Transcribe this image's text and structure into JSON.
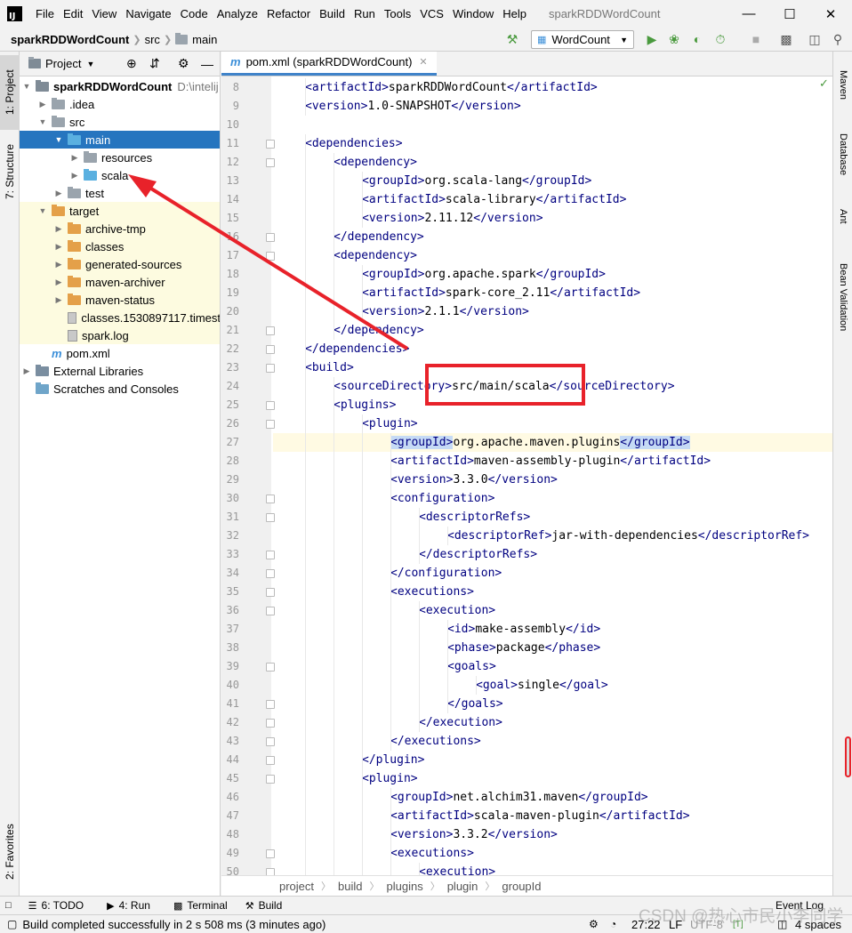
{
  "menubar": {
    "logo": "IJ",
    "items": [
      {
        "label": "File"
      },
      {
        "label": "Edit"
      },
      {
        "label": "View"
      },
      {
        "label": "Navigate"
      },
      {
        "label": "Code"
      },
      {
        "label": "Analyze"
      },
      {
        "label": "Refactor"
      },
      {
        "label": "Build"
      },
      {
        "label": "Run"
      },
      {
        "label": "Tools"
      },
      {
        "label": "VCS"
      },
      {
        "label": "Window"
      },
      {
        "label": "Help"
      }
    ],
    "window_title": "sparkRDDWordCount"
  },
  "navbar": {
    "crumbs": [
      "sparkRDDWordCount",
      "src",
      "main"
    ],
    "run_config": "WordCount"
  },
  "left_strip": {
    "project_tab": "1: Project",
    "structure_tab": "7: Structure",
    "favorites_tab": "2: Favorites"
  },
  "right_strip": {
    "tabs": [
      "Maven",
      "Database",
      "Ant",
      "Bean Validation"
    ]
  },
  "project": {
    "title": "Project",
    "tree": [
      {
        "label": "sparkRDDWordCount",
        "extra": "D:\\intelij"
      },
      {
        "label": ".idea"
      },
      {
        "label": "src"
      },
      {
        "label": "main"
      },
      {
        "label": "resources"
      },
      {
        "label": "scala"
      },
      {
        "label": "test"
      },
      {
        "label": "target"
      },
      {
        "label": "archive-tmp"
      },
      {
        "label": "classes"
      },
      {
        "label": "generated-sources"
      },
      {
        "label": "maven-archiver"
      },
      {
        "label": "maven-status"
      },
      {
        "label": "classes.1530897117.timest"
      },
      {
        "label": "spark.log"
      },
      {
        "label": "pom.xml"
      },
      {
        "label": "External Libraries"
      },
      {
        "label": "Scratches and Consoles"
      }
    ]
  },
  "editor": {
    "tab_label": "pom.xml (sparkRDDWordCount)",
    "lines": [
      {
        "num": "8",
        "indent": 1,
        "parts": [
          [
            "tag",
            "<artifactId>"
          ],
          [
            "text",
            "sparkRDDWordCount"
          ],
          [
            "tag",
            "</artifactId>"
          ]
        ]
      },
      {
        "num": "9",
        "indent": 1,
        "parts": [
          [
            "tag",
            "<version>"
          ],
          [
            "text",
            "1.0-SNAPSHOT"
          ],
          [
            "tag",
            "</version>"
          ]
        ]
      },
      {
        "num": "10",
        "indent": 0,
        "parts": []
      },
      {
        "num": "11",
        "indent": 1,
        "parts": [
          [
            "tag",
            "<dependencies>"
          ]
        ]
      },
      {
        "num": "12",
        "indent": 2,
        "parts": [
          [
            "tag",
            "<dependency>"
          ]
        ]
      },
      {
        "num": "13",
        "indent": 3,
        "parts": [
          [
            "tag",
            "<groupId>"
          ],
          [
            "text",
            "org.scala-lang"
          ],
          [
            "tag",
            "</groupId>"
          ]
        ]
      },
      {
        "num": "14",
        "indent": 3,
        "parts": [
          [
            "tag",
            "<artifactId>"
          ],
          [
            "text",
            "scala-library"
          ],
          [
            "tag",
            "</artifactId>"
          ]
        ]
      },
      {
        "num": "15",
        "indent": 3,
        "parts": [
          [
            "tag",
            "<version>"
          ],
          [
            "text",
            "2.11.12"
          ],
          [
            "tag",
            "</version>"
          ]
        ]
      },
      {
        "num": "16",
        "indent": 2,
        "parts": [
          [
            "tag",
            "</dependency>"
          ]
        ]
      },
      {
        "num": "17",
        "indent": 2,
        "parts": [
          [
            "tag",
            "<dependency>"
          ]
        ]
      },
      {
        "num": "18",
        "indent": 3,
        "parts": [
          [
            "tag",
            "<groupId>"
          ],
          [
            "text",
            "org.apache.spark"
          ],
          [
            "tag",
            "</groupId>"
          ]
        ]
      },
      {
        "num": "19",
        "indent": 3,
        "parts": [
          [
            "tag",
            "<artifactId>"
          ],
          [
            "text",
            "spark-core_2.11"
          ],
          [
            "tag",
            "</artifactId>"
          ]
        ]
      },
      {
        "num": "20",
        "indent": 3,
        "parts": [
          [
            "tag",
            "<version>"
          ],
          [
            "text",
            "2.1.1"
          ],
          [
            "tag",
            "</version>"
          ]
        ]
      },
      {
        "num": "21",
        "indent": 2,
        "parts": [
          [
            "tag",
            "</dependency>"
          ]
        ]
      },
      {
        "num": "22",
        "indent": 1,
        "parts": [
          [
            "tag",
            "</dependencies>"
          ]
        ]
      },
      {
        "num": "23",
        "indent": 1,
        "parts": [
          [
            "tag",
            "<build>"
          ]
        ]
      },
      {
        "num": "24",
        "indent": 2,
        "parts": [
          [
            "tag",
            "<sourceDirectory>"
          ],
          [
            "text",
            "src/main/scala"
          ],
          [
            "tag",
            "</sourceDirectory>"
          ]
        ]
      },
      {
        "num": "25",
        "indent": 2,
        "parts": [
          [
            "tag",
            "<plugins>"
          ]
        ]
      },
      {
        "num": "26",
        "indent": 3,
        "parts": [
          [
            "tag",
            "<plugin>"
          ]
        ]
      },
      {
        "num": "27",
        "indent": 4,
        "current": true,
        "parts": [
          [
            "taghl",
            "<groupId>"
          ],
          [
            "text",
            "org.apache.maven.plugins"
          ],
          [
            "taghl",
            "</groupId>"
          ]
        ]
      },
      {
        "num": "28",
        "indent": 4,
        "parts": [
          [
            "tag",
            "<artifactId>"
          ],
          [
            "text",
            "maven-assembly-plugin"
          ],
          [
            "tag",
            "</artifactId>"
          ]
        ]
      },
      {
        "num": "29",
        "indent": 4,
        "parts": [
          [
            "tag",
            "<version>"
          ],
          [
            "text",
            "3.3.0"
          ],
          [
            "tag",
            "</version>"
          ]
        ]
      },
      {
        "num": "30",
        "indent": 4,
        "parts": [
          [
            "tag",
            "<configuration>"
          ]
        ]
      },
      {
        "num": "31",
        "indent": 5,
        "parts": [
          [
            "tag",
            "<descriptorRefs>"
          ]
        ]
      },
      {
        "num": "32",
        "indent": 6,
        "parts": [
          [
            "tag",
            "<descriptorRef>"
          ],
          [
            "text",
            "jar-with-dependencies"
          ],
          [
            "tag",
            "</descriptorRef>"
          ]
        ]
      },
      {
        "num": "33",
        "indent": 5,
        "parts": [
          [
            "tag",
            "</descriptorRefs>"
          ]
        ]
      },
      {
        "num": "34",
        "indent": 4,
        "parts": [
          [
            "tag",
            "</configuration>"
          ]
        ]
      },
      {
        "num": "35",
        "indent": 4,
        "parts": [
          [
            "tag",
            "<executions>"
          ]
        ]
      },
      {
        "num": "36",
        "indent": 5,
        "parts": [
          [
            "tag",
            "<execution>"
          ]
        ]
      },
      {
        "num": "37",
        "indent": 6,
        "parts": [
          [
            "tag",
            "<id>"
          ],
          [
            "text",
            "make-assembly"
          ],
          [
            "tag",
            "</id>"
          ]
        ]
      },
      {
        "num": "38",
        "indent": 6,
        "parts": [
          [
            "tag",
            "<phase>"
          ],
          [
            "text",
            "package"
          ],
          [
            "tag",
            "</phase>"
          ]
        ]
      },
      {
        "num": "39",
        "indent": 6,
        "parts": [
          [
            "tag",
            "<goals>"
          ]
        ]
      },
      {
        "num": "40",
        "indent": 7,
        "parts": [
          [
            "tag",
            "<goal>"
          ],
          [
            "text",
            "single"
          ],
          [
            "tag",
            "</goal>"
          ]
        ]
      },
      {
        "num": "41",
        "indent": 6,
        "parts": [
          [
            "tag",
            "</goals>"
          ]
        ]
      },
      {
        "num": "42",
        "indent": 5,
        "parts": [
          [
            "tag",
            "</execution>"
          ]
        ]
      },
      {
        "num": "43",
        "indent": 4,
        "parts": [
          [
            "tag",
            "</executions>"
          ]
        ]
      },
      {
        "num": "44",
        "indent": 3,
        "parts": [
          [
            "tag",
            "</plugin>"
          ]
        ]
      },
      {
        "num": "45",
        "indent": 3,
        "parts": [
          [
            "tag",
            "<plugin>"
          ]
        ]
      },
      {
        "num": "46",
        "indent": 4,
        "parts": [
          [
            "tag",
            "<groupId>"
          ],
          [
            "text",
            "net.alchim31.maven"
          ],
          [
            "tag",
            "</groupId>"
          ]
        ]
      },
      {
        "num": "47",
        "indent": 4,
        "parts": [
          [
            "tag",
            "<artifactId>"
          ],
          [
            "text",
            "scala-maven-plugin"
          ],
          [
            "tag",
            "</artifactId>"
          ]
        ]
      },
      {
        "num": "48",
        "indent": 4,
        "parts": [
          [
            "tag",
            "<version>"
          ],
          [
            "text",
            "3.3.2"
          ],
          [
            "tag",
            "</version>"
          ]
        ]
      },
      {
        "num": "49",
        "indent": 4,
        "parts": [
          [
            "tag",
            "<executions>"
          ]
        ]
      },
      {
        "num": "50",
        "indent": 5,
        "parts": [
          [
            "tag",
            "<execution>"
          ]
        ]
      }
    ]
  },
  "breadcrumb": [
    "project",
    "build",
    "plugins",
    "plugin",
    "groupId"
  ],
  "bottom_tabs": {
    "todo": "6: TODO",
    "run": "4: Run",
    "terminal": "Terminal",
    "build": "Build",
    "event_log": "Event Log"
  },
  "status": {
    "message": "Build completed successfully in 2 s 508 ms (3 minutes ago)",
    "position": "27:22",
    "line_sep": "LF",
    "encoding": "UTF-8",
    "indent": "4 spaces"
  },
  "watermark": "CSDN @热心市民小李同学",
  "colors": {
    "selection": "#2675bf",
    "tag": "#000080",
    "annotation": "#e8222a"
  }
}
